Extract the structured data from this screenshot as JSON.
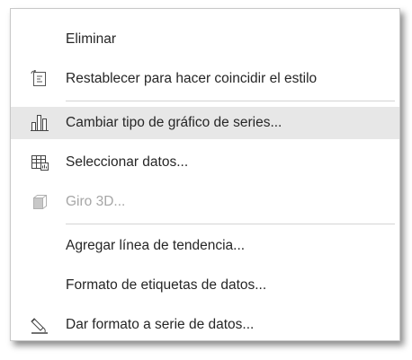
{
  "context_menu": {
    "items": [
      {
        "label": "Eliminar",
        "icon": "none",
        "enabled": true
      },
      {
        "label": "Restablecer para hacer coincidir el estilo",
        "icon": "reset-style-icon",
        "enabled": true
      },
      {
        "label": "Cambiar tipo de gráfico de series...",
        "icon": "bar-chart-icon",
        "enabled": true,
        "highlighted": true
      },
      {
        "label": "Seleccionar datos...",
        "icon": "select-data-icon",
        "enabled": true
      },
      {
        "label": "Giro 3D...",
        "icon": "3d-rotation-icon",
        "enabled": false
      },
      {
        "label": "Agregar línea de tendencia...",
        "icon": "none",
        "enabled": true
      },
      {
        "label": "Formato de etiquetas de datos...",
        "icon": "none",
        "enabled": true
      },
      {
        "label": "Dar formato a serie de datos...",
        "icon": "format-series-icon",
        "enabled": true
      }
    ]
  },
  "colors": {
    "highlight": "#e7e7e7",
    "text": "#262626",
    "disabled_text": "#a6a6a6",
    "separator": "#d4d4d4"
  }
}
